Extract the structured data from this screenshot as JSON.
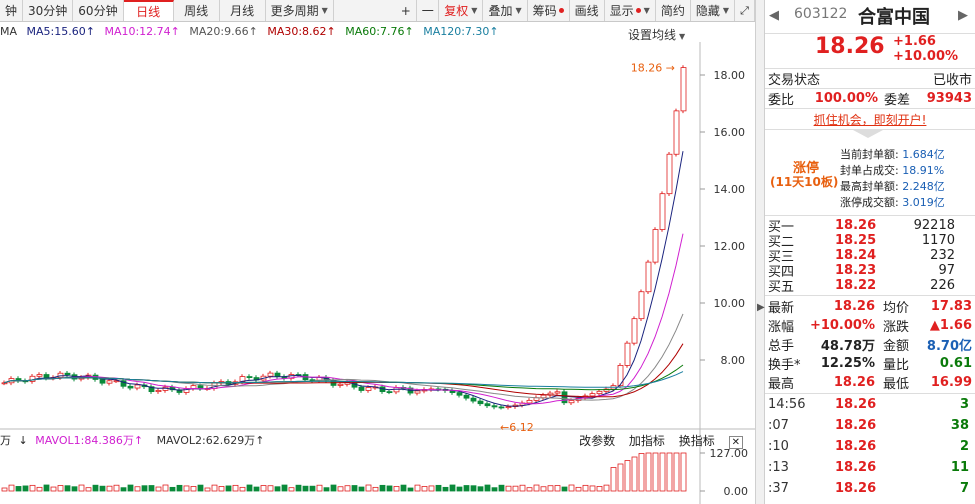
{
  "toolbar": {
    "tabs": [
      "钟",
      "30分钟",
      "60分钟",
      "日线",
      "周线",
      "月线",
      "更多周期"
    ],
    "active": "日线",
    "plus": "+",
    "minus": "一",
    "tools": [
      "复权",
      "叠加",
      "筹码",
      "画线",
      "显示",
      "简约",
      "隐藏"
    ],
    "active_tool": "复权"
  },
  "ma_bar": {
    "items": [
      {
        "label": "MA",
        "color": "#333"
      },
      {
        "label": "MA5:15.60",
        "color": "#1a237e"
      },
      {
        "label": "MA10:12.74",
        "color": "#d020d0"
      },
      {
        "label": "MA20:9.66",
        "color": "#888888"
      },
      {
        "label": "MA30:8.62",
        "color": "#b00000"
      },
      {
        "label": "MA60:7.76",
        "color": "#0a7a0a"
      },
      {
        "label": "MA120:7.30",
        "color": "#1a7fa0"
      }
    ],
    "setting": "设置均线"
  },
  "price_axis": [
    "18.00",
    "16.00",
    "14.00",
    "12.00",
    "10.00",
    "8.00"
  ],
  "annotations": {
    "high": "18.26",
    "low": "6.12"
  },
  "vol_bar": {
    "prefix": "万",
    "items": [
      {
        "label": "MAVOL1:84.386万",
        "color": "#d020d0"
      },
      {
        "label": "MAVOL2:62.629万",
        "color": "#333"
      }
    ],
    "buttons": [
      "改参数",
      "加指标",
      "换指标"
    ],
    "axis": [
      "127.00",
      "0.00"
    ]
  },
  "quote": {
    "code": "603122",
    "name": "合富中国",
    "price": "18.26",
    "chg": "+1.66",
    "pct": "+10.00%",
    "status_label": "交易状态",
    "status": "已收市",
    "wb_label": "委比",
    "wb": "100.00%",
    "wc_label": "委差",
    "wc": "93943",
    "promo": "抓住机会，即刻开户!",
    "limit_title": "涨停",
    "limit_days": "(11天10板)",
    "limit_info": [
      {
        "k": "当前封单额:",
        "v": "1.684亿"
      },
      {
        "k": "封单占成交:",
        "v": "18.91%"
      },
      {
        "k": "最高封单额:",
        "v": "2.248亿"
      },
      {
        "k": "涨停成交额:",
        "v": "3.019亿"
      }
    ],
    "book": [
      {
        "n": "买一",
        "p": "18.26",
        "v": "92218"
      },
      {
        "n": "买二",
        "p": "18.25",
        "v": "1170"
      },
      {
        "n": "买三",
        "p": "18.24",
        "v": "232"
      },
      {
        "n": "买四",
        "p": "18.23",
        "v": "97"
      },
      {
        "n": "买五",
        "p": "18.22",
        "v": "226"
      }
    ],
    "stats": [
      {
        "k1": "最新",
        "v1": "18.26",
        "c1": "red",
        "k2": "均价",
        "v2": "17.83",
        "c2": "red"
      },
      {
        "k1": "涨幅",
        "v1": "+10.00%",
        "c1": "red",
        "k2": "涨跌",
        "v2": "▲1.66",
        "c2": "red"
      },
      {
        "k1": "总手",
        "v1": "48.78万",
        "c1": "",
        "k2": "金额",
        "v2": "8.70亿",
        "c2": "blue"
      },
      {
        "k1": "换手*",
        "v1": "12.25%",
        "c1": "",
        "k2": "量比",
        "v2": "0.61",
        "c2": "grn"
      },
      {
        "k1": "最高",
        "v1": "18.26",
        "c1": "red",
        "k2": "最低",
        "v2": "16.99",
        "c2": "red"
      }
    ],
    "ticks": [
      {
        "t": "14:56",
        "p": "18.26",
        "v": "3"
      },
      {
        "t": ":07",
        "p": "18.26",
        "v": "38"
      },
      {
        "t": ":10",
        "p": "18.26",
        "v": "2"
      },
      {
        "t": ":13",
        "p": "18.26",
        "v": "11"
      },
      {
        "t": ":37",
        "p": "18.26",
        "v": "7"
      }
    ]
  }
}
